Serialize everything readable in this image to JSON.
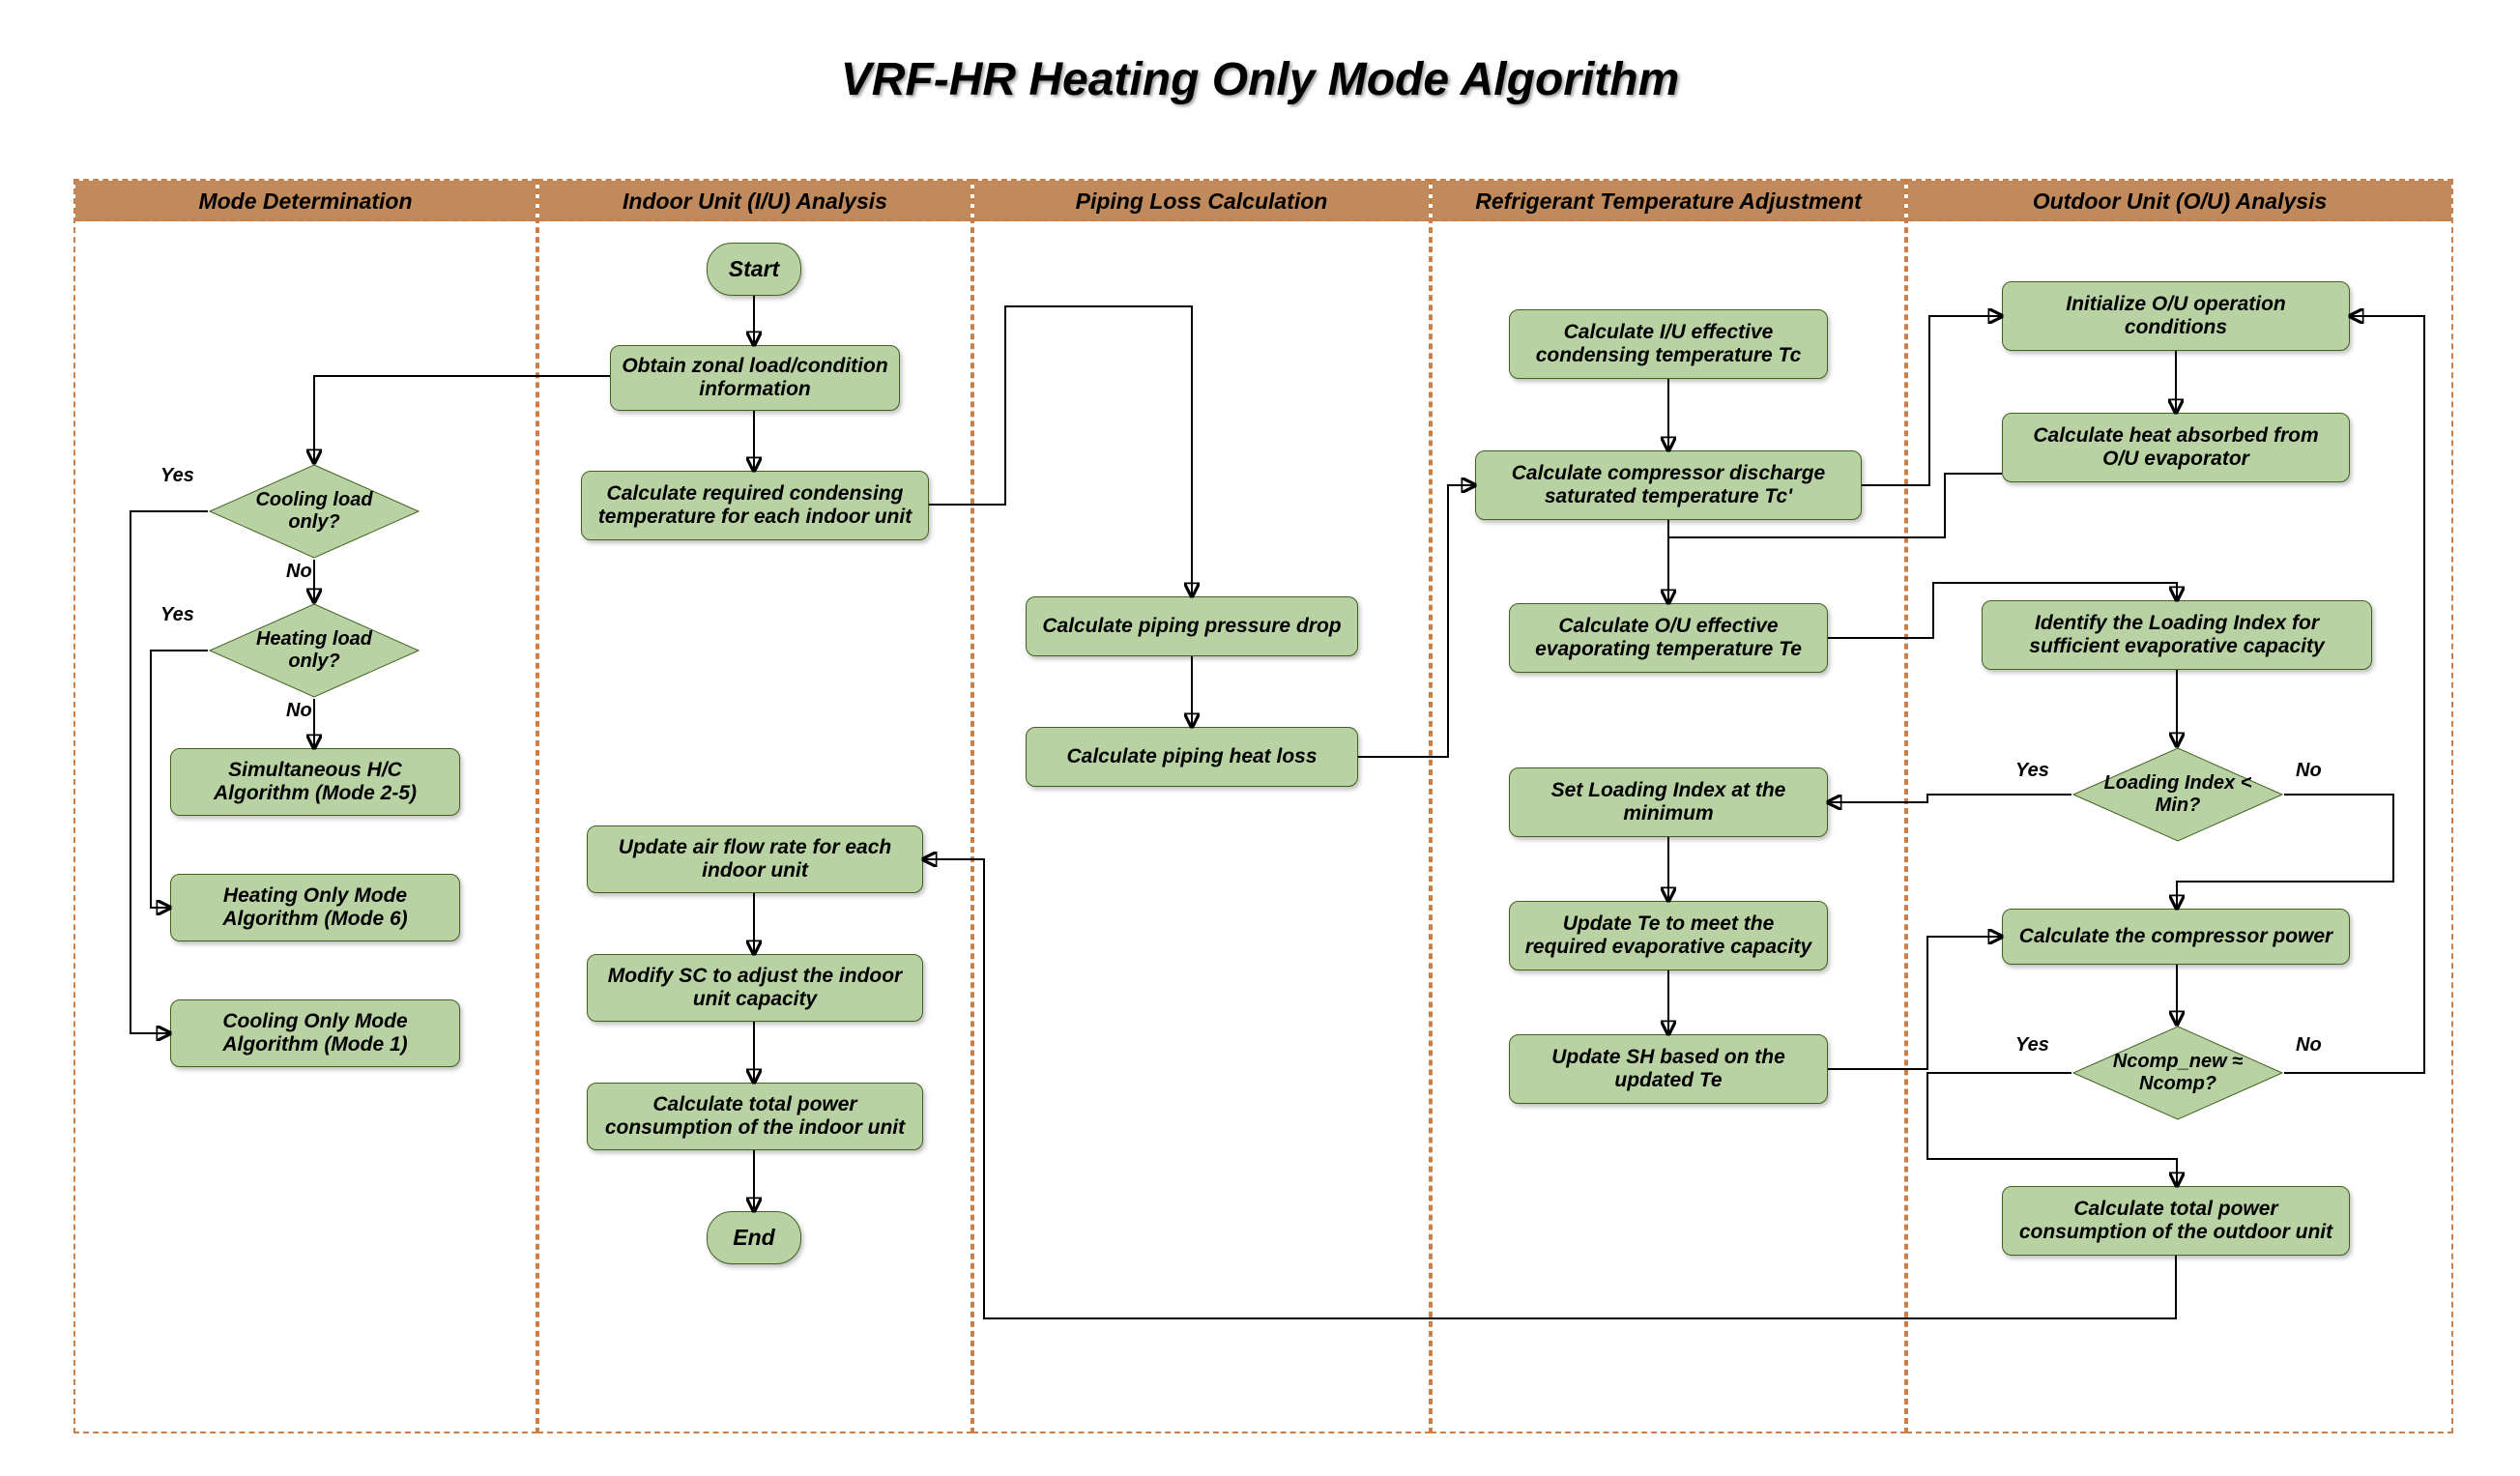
{
  "title": "VRF-HR Heating Only Mode Algorithm",
  "lanes": {
    "mode": "Mode Determination",
    "iu": "Indoor Unit (I/U) Analysis",
    "piping": "Piping Loss Calculation",
    "rta": "Refrigerant Temperature Adjustment",
    "ou": "Outdoor Unit (O/U) Analysis"
  },
  "nodes": {
    "start": "Start",
    "end": "End",
    "obtain_zonal": "Obtain zonal load/condition information",
    "calc_cond_iu": "Calculate required condensing temperature for each indoor unit",
    "update_airflow": "Update air flow rate for each indoor unit",
    "modify_sc": "Modify SC to adjust the indoor unit capacity",
    "iu_power": "Calculate total power consumption of the indoor unit",
    "piping_drop": "Calculate piping pressure drop",
    "piping_heat": "Calculate piping  heat loss",
    "calc_tc": "Calculate I/U effective condensing temperature Tc",
    "calc_tcp": "Calculate compressor discharge saturated temperature Tc'",
    "calc_te": "Calculate O/U effective evaporating temperature Te",
    "set_li": "Set Loading Index at the minimum",
    "update_te": "Update Te to meet the required evaporative capacity",
    "update_sh": "Update SH based on the updated Te",
    "init_ou": "Initialize O/U operation conditions",
    "heat_abs": "Calculate heat absorbed from O/U evaporator",
    "identify_li": "Identify the Loading Index for sufficient evaporative capacity",
    "calc_comp": "Calculate the compressor power",
    "ou_power": "Calculate total power consumption of the outdoor unit",
    "simul": "Simultaneous H/C Algorithm (Mode 2-5)",
    "heat_only": "Heating Only Mode Algorithm (Mode 6)",
    "cool_only": "Cooling Only Mode Algorithm (Mode 1)"
  },
  "decisions": {
    "cooling": "Cooling load only?",
    "heating": "Heating load only?",
    "limin": "Loading Index < Min?",
    "ncomp": "Ncomp_new ≈  Ncomp?"
  },
  "labels": {
    "yes": "Yes",
    "no": "No"
  }
}
